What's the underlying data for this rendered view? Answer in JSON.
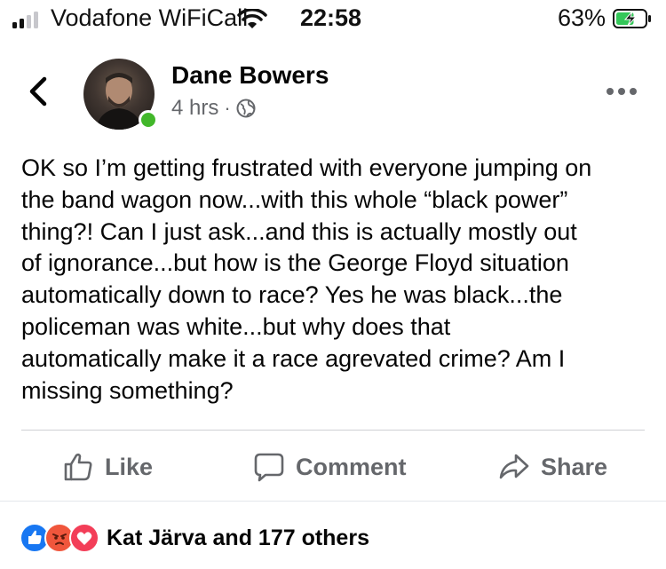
{
  "status_bar": {
    "carrier": "Vodafone WiFiCall",
    "time": "22:58",
    "battery_percent": "63%",
    "battery_level": 0.63,
    "signal_bars_active": 2,
    "signal_bars_total": 4,
    "charging": true
  },
  "post": {
    "author": "Dane Bowers",
    "time_ago": "4 hrs",
    "separator": "·",
    "audience_icon": "globe-icon",
    "online": true,
    "text": "OK so I’m getting frustrated with everyone jumping on\nthe band wagon now...with this whole “black power”\nthing?! Can I just ask...and this is actually mostly out\nof ignorance...but how is the George Floyd situation\nautomatically down to race? Yes he was black...the\npoliceman was white...but why does that\nautomatically make it a race agrevated crime? Am I\nmissing something?"
  },
  "actions": {
    "like_label": "Like",
    "comment_label": "Comment",
    "share_label": "Share"
  },
  "reactions": {
    "icons": [
      "like-reaction-icon",
      "angry-reaction-icon",
      "love-reaction-icon"
    ],
    "summary": "Kat Järva and 177 others"
  },
  "colors": {
    "text_primary": "#050505",
    "text_secondary": "#65676b",
    "online_green": "#42b72a",
    "like_blue": "#1877f2",
    "angry_orange": "#f0563c",
    "love_red": "#f33e58",
    "battery_green": "#34c759"
  }
}
